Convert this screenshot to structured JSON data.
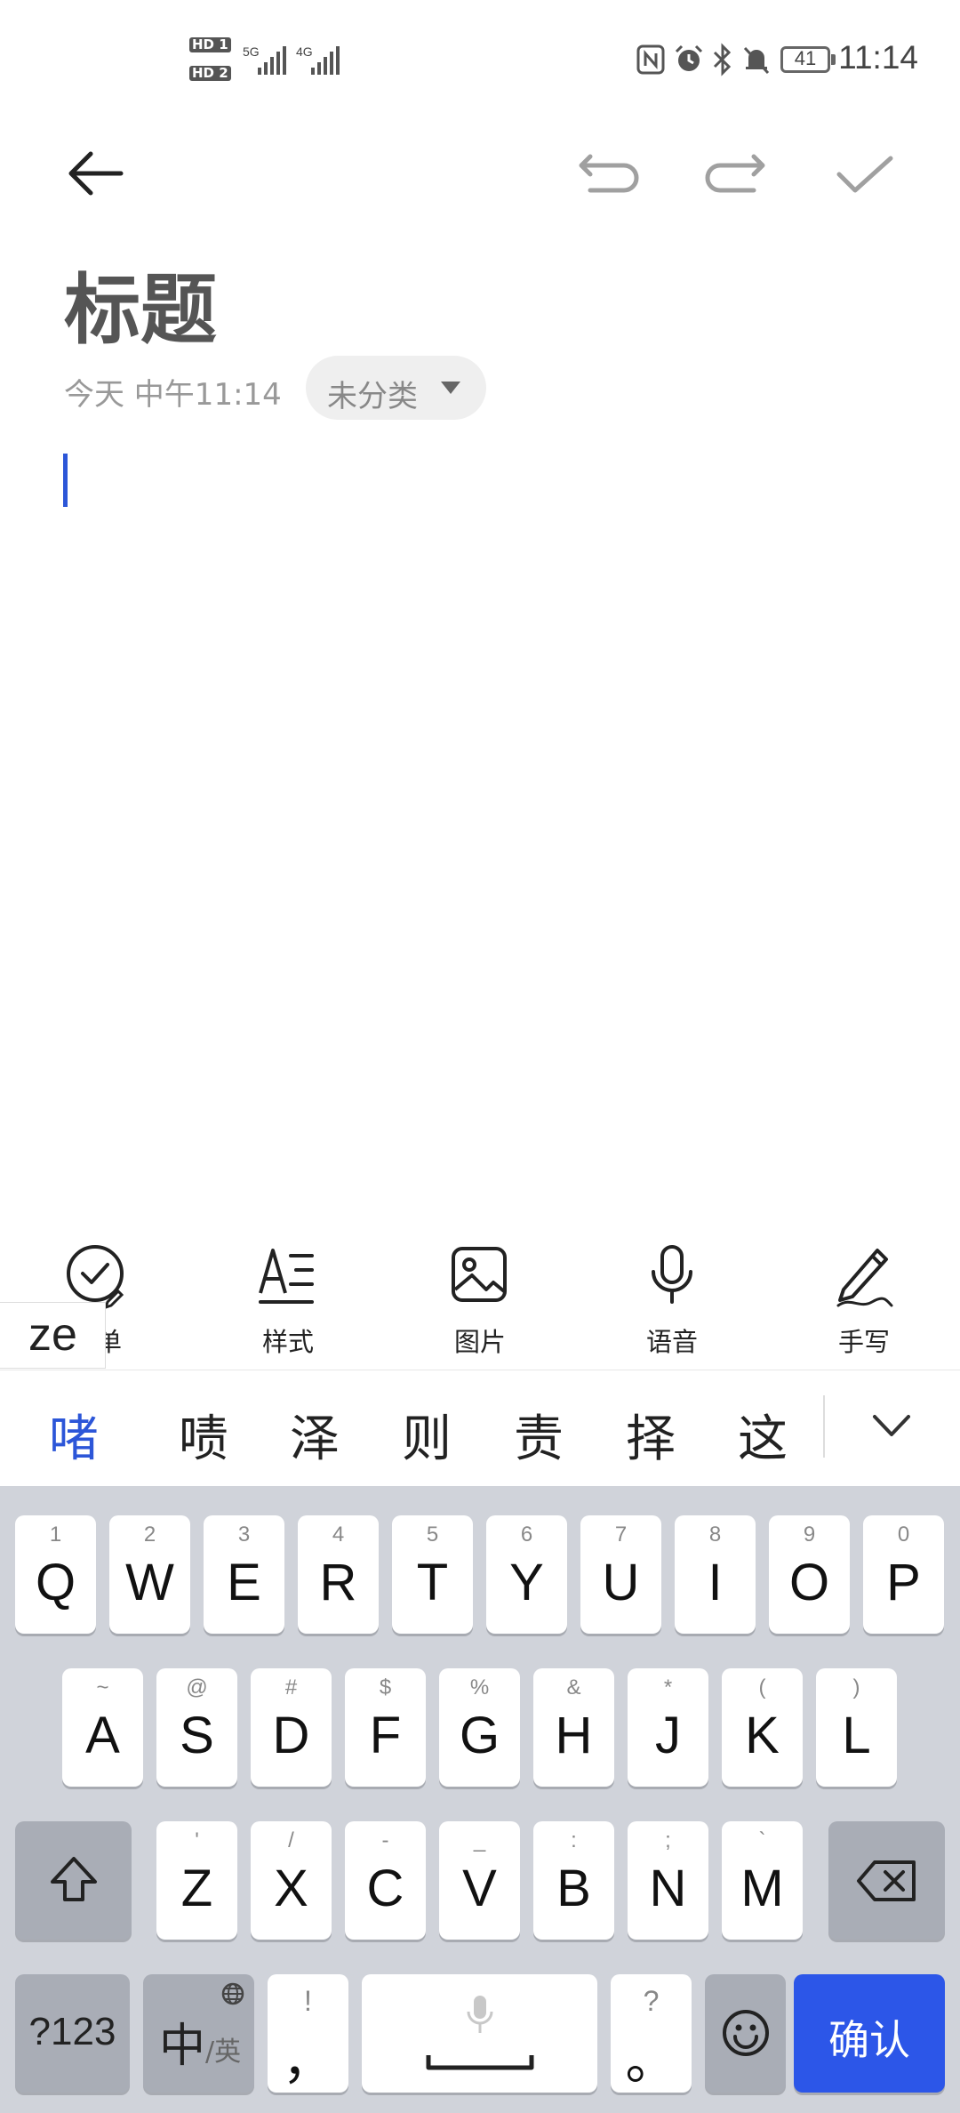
{
  "status_bar": {
    "time": "11:14",
    "battery": "41",
    "sim1_hd": "HD 1",
    "sim2_hd": "HD 2",
    "network1": "5G",
    "network2": "4G"
  },
  "header": {
    "back_icon": "arrow-left-icon",
    "undo_icon": "undo-icon",
    "redo_icon": "redo-icon",
    "confirm_icon": "check-icon"
  },
  "note": {
    "title": "标题",
    "date": "今天 中午11:14",
    "category": "未分类"
  },
  "toolbar": {
    "items": [
      {
        "label": "清单",
        "icon": "checklist-icon"
      },
      {
        "label": "样式",
        "icon": "text-style-icon"
      },
      {
        "label": "图片",
        "icon": "image-icon"
      },
      {
        "label": "语音",
        "icon": "microphone-icon"
      },
      {
        "label": "手写",
        "icon": "pen-icon"
      }
    ]
  },
  "ime": {
    "composing": "ze",
    "candidates": [
      "啫",
      "啧",
      "泽",
      "则",
      "责",
      "择",
      "这"
    ],
    "expand_icon": "chevron-down-icon"
  },
  "keyboard": {
    "row1": [
      {
        "hint": "1",
        "key": "Q"
      },
      {
        "hint": "2",
        "key": "W"
      },
      {
        "hint": "3",
        "key": "E"
      },
      {
        "hint": "4",
        "key": "R"
      },
      {
        "hint": "5",
        "key": "T"
      },
      {
        "hint": "6",
        "key": "Y"
      },
      {
        "hint": "7",
        "key": "U"
      },
      {
        "hint": "8",
        "key": "I"
      },
      {
        "hint": "9",
        "key": "O"
      },
      {
        "hint": "0",
        "key": "P"
      }
    ],
    "row2": [
      {
        "hint": "~",
        "key": "A"
      },
      {
        "hint": "@",
        "key": "S"
      },
      {
        "hint": "#",
        "key": "D"
      },
      {
        "hint": "$",
        "key": "F"
      },
      {
        "hint": "%",
        "key": "G"
      },
      {
        "hint": "&",
        "key": "H"
      },
      {
        "hint": "*",
        "key": "J"
      },
      {
        "hint": "(",
        "key": "K"
      },
      {
        "hint": ")",
        "key": "L"
      }
    ],
    "row3": [
      {
        "hint": "'",
        "key": "Z"
      },
      {
        "hint": "/",
        "key": "X"
      },
      {
        "hint": "-",
        "key": "C"
      },
      {
        "hint": "_",
        "key": "V"
      },
      {
        "hint": ":",
        "key": "B"
      },
      {
        "hint": ";",
        "key": "N"
      },
      {
        "hint": "`",
        "key": "M"
      }
    ],
    "numbers_key": "?123",
    "lang_key_main": "中",
    "lang_key_sub": "/英",
    "comma_hint": "!",
    "comma_key": "，",
    "period_hint": "?",
    "period_key": "。",
    "enter_key": "确认"
  }
}
